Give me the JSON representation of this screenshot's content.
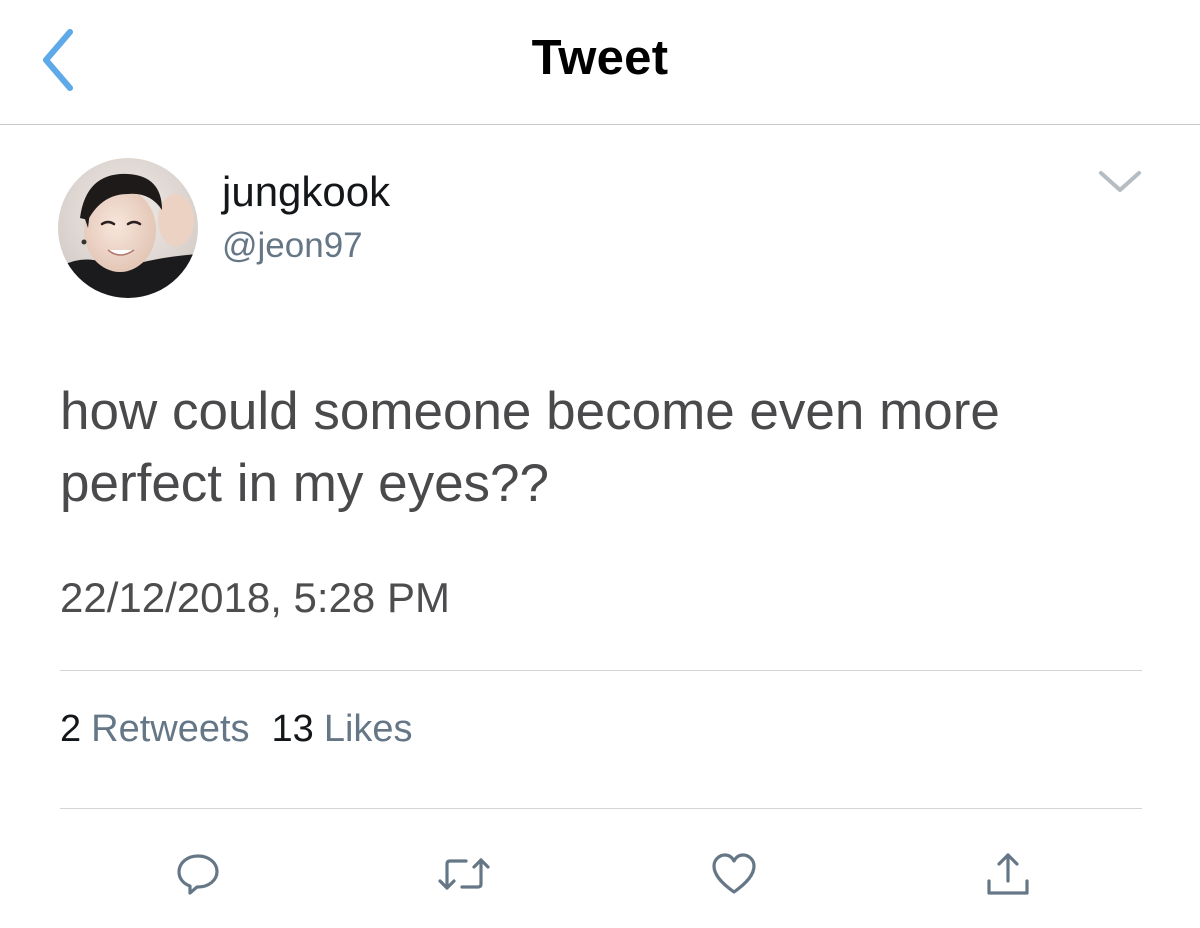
{
  "header": {
    "title": "Tweet",
    "back_icon": "chevron-left-icon"
  },
  "author": {
    "name": "jungkook",
    "handle": "@jeon97",
    "avatar": "profile-photo"
  },
  "tweet": {
    "text_line1": "how could someone become even more",
    "text_line2": "perfect in my eyes??",
    "timestamp": "22/12/2018, 5:28 PM"
  },
  "stats": {
    "retweets_count": "2",
    "retweets_label": "Retweets",
    "likes_count": "13",
    "likes_label": "Likes"
  },
  "actions": [
    "reply-icon",
    "retweet-icon",
    "like-icon",
    "share-icon"
  ],
  "colors": {
    "accent": "#1da1f2",
    "back_chevron": "#5ea9e8",
    "icon_gray": "#657786",
    "text_primary": "#14171a",
    "divider": "#d4d4d6"
  }
}
